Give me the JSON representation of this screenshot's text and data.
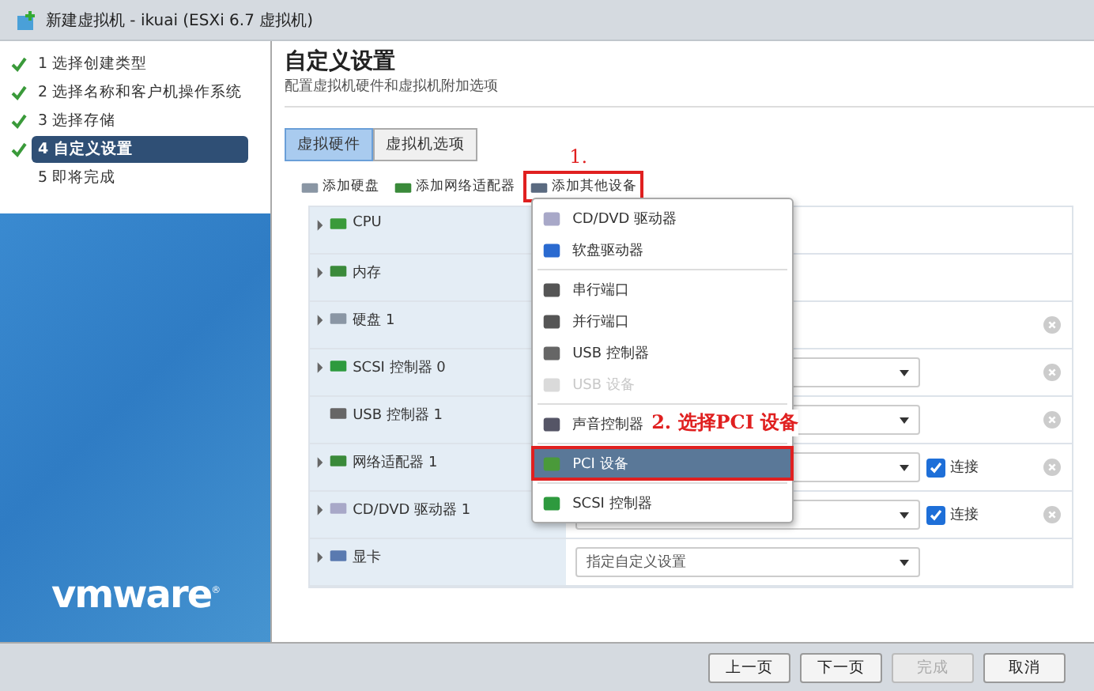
{
  "window": {
    "title": "新建虚拟机 - ikuai (ESXi 6.7 虚拟机)"
  },
  "steps": [
    {
      "label": "1 选择创建类型",
      "done": true,
      "selected": false
    },
    {
      "label": "2 选择名称和客户机操作系统",
      "done": true,
      "selected": false
    },
    {
      "label": "3 选择存储",
      "done": true,
      "selected": false
    },
    {
      "label": "4 自定义设置",
      "done": true,
      "selected": true
    },
    {
      "label": "5 即将完成",
      "done": false,
      "selected": false
    }
  ],
  "logo": {
    "text": "vmware",
    "mark": "®"
  },
  "page": {
    "title": "自定义设置",
    "subtitle": "配置虚拟机硬件和虚拟机附加选项"
  },
  "tabs": [
    {
      "label": "虚拟硬件",
      "selected": true
    },
    {
      "label": "虚拟机选项",
      "selected": false
    }
  ],
  "toolbar": [
    {
      "label": "添加硬盘",
      "highlighted": false
    },
    {
      "label": "添加网络适配器",
      "highlighted": false
    },
    {
      "label": "添加其他设备",
      "highlighted": true
    }
  ],
  "hardware": [
    {
      "label": "CPU",
      "expandable": true,
      "kind": "plain",
      "removable": false
    },
    {
      "label": "内存",
      "expandable": true,
      "kind": "plain",
      "removable": false
    },
    {
      "label": "硬盘 1",
      "expandable": true,
      "kind": "plain",
      "removable": true
    },
    {
      "label": "SCSI 控制器 0",
      "expandable": true,
      "kind": "select",
      "removable": true
    },
    {
      "label": "USB 控制器 1",
      "expandable": false,
      "kind": "select",
      "removable": true
    },
    {
      "label": "网络适配器 1",
      "expandable": true,
      "kind": "select_connect",
      "connect": {
        "label": "连接",
        "checked": true
      },
      "removable": true
    },
    {
      "label": "CD/DVD 驱动器 1",
      "expandable": true,
      "kind": "select_connect",
      "connect": {
        "label": "连接",
        "checked": true
      },
      "removable": true
    },
    {
      "label": "显卡",
      "expandable": true,
      "kind": "select",
      "value": "指定自定义设置",
      "removable": false
    }
  ],
  "menu": [
    {
      "kind": "item",
      "label": "CD/DVD 驱动器",
      "disabled": false,
      "selected": false
    },
    {
      "kind": "item",
      "label": "软盘驱动器",
      "disabled": false,
      "selected": false
    },
    {
      "kind": "separator"
    },
    {
      "kind": "item",
      "label": "串行端口",
      "disabled": false,
      "selected": false
    },
    {
      "kind": "item",
      "label": "并行端口",
      "disabled": false,
      "selected": false
    },
    {
      "kind": "item",
      "label": "USB 控制器",
      "disabled": false,
      "selected": false
    },
    {
      "kind": "item",
      "label": "USB 设备",
      "disabled": true,
      "selected": false
    },
    {
      "kind": "separator"
    },
    {
      "kind": "item",
      "label": "声音控制器",
      "disabled": false,
      "selected": false
    },
    {
      "kind": "separator"
    },
    {
      "kind": "item",
      "label": "PCI 设备",
      "disabled": false,
      "selected": true
    },
    {
      "kind": "separator"
    },
    {
      "kind": "item",
      "label": "SCSI 控制器",
      "disabled": false,
      "selected": false
    }
  ],
  "annotations": [
    {
      "text": "1."
    },
    {
      "text": "2. 选择PCI 设备"
    }
  ],
  "buttons": [
    {
      "label": "上一页",
      "disabled": false
    },
    {
      "label": "下一页",
      "disabled": false
    },
    {
      "label": "完成",
      "disabled": true
    },
    {
      "label": "取消",
      "disabled": false
    }
  ]
}
